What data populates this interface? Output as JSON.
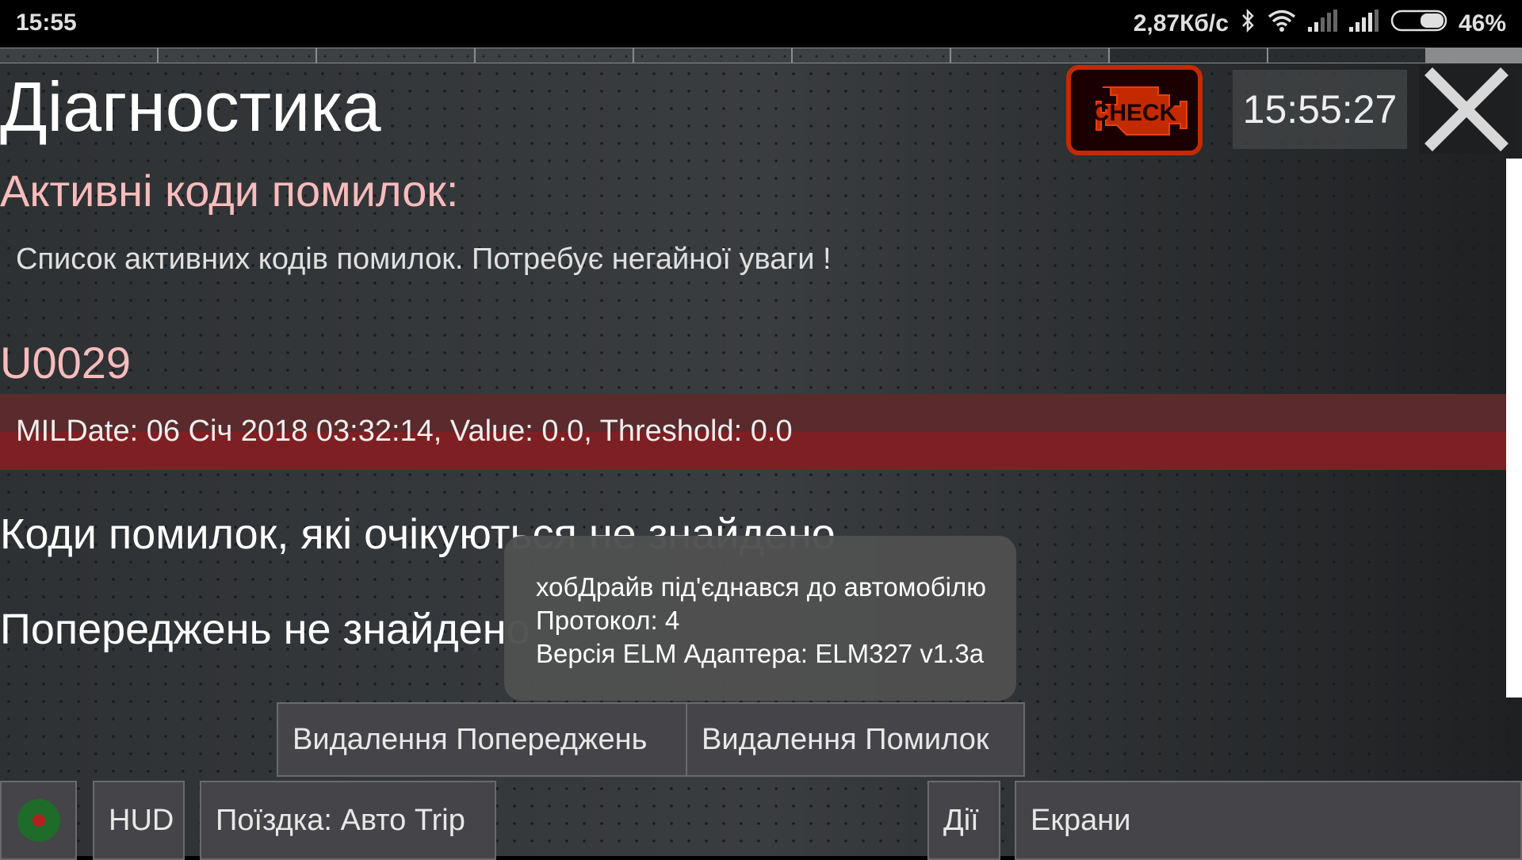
{
  "status_bar": {
    "time": "15:55",
    "network_speed": "2,87Кб/с",
    "battery_percent": "46%",
    "battery_level": 0.46,
    "icons": [
      "bluetooth-icon",
      "wifi-icon",
      "signal-icon",
      "signal-icon",
      "battery-icon"
    ]
  },
  "header": {
    "title": "Діагностика",
    "check_engine_label": "CHECK",
    "clock": "15:55:27"
  },
  "active_codes": {
    "heading": "Активні коди помилок:",
    "description": "Список активних кодів помилок. Потребує негайної уваги !",
    "codes": [
      {
        "code": "U0029",
        "details": "MILDate: 06 Січ 2018 03:32:14, Value: 0.0, Threshold: 0.0"
      }
    ]
  },
  "pending_codes_text": "Коди помилок, які очікуються не знайдено",
  "warnings_text": "Попереджень не знайдено",
  "toast": {
    "line1": "хобДрайв під'єднався до автомобілю",
    "line2": "Протокол: 4",
    "line3": "Версія ELM Адаптера: ELM327 v1.3a"
  },
  "actions": {
    "clear_warnings": "Видалення Попереджень",
    "clear_errors": "Видалення Помилок"
  },
  "bottom_bar": {
    "hud": "HUD",
    "trip": "Поїздка: Авто Trip",
    "actions": "Дії",
    "screens": "Екрани"
  }
}
